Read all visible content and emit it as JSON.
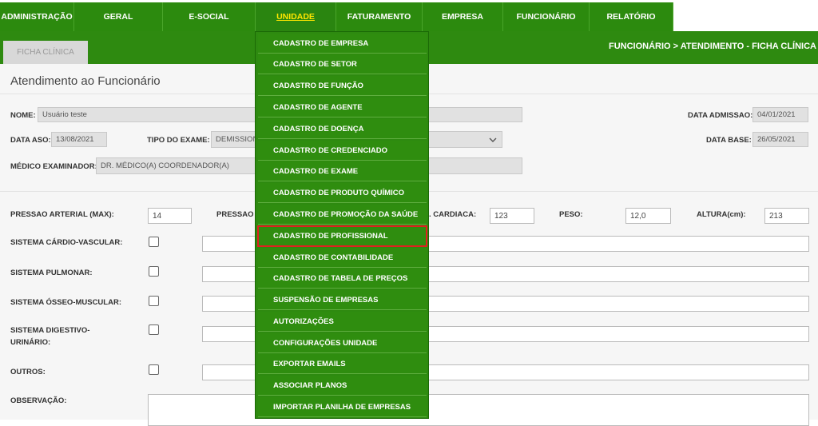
{
  "nav": {
    "items": [
      "ADMINISTRAÇÃO",
      "GERAL",
      "E-SOCIAL",
      "UNIDADE",
      "FATURAMENTO",
      "EMPRESA",
      "FUNCIONÁRIO",
      "RELATÓRIO"
    ],
    "active": "UNIDADE"
  },
  "tab": {
    "label": "FICHA CLÍNICA"
  },
  "breadcrumb": "FUNCIONÁRIO > ATENDIMENTO - FICHA CLÍNICA",
  "page_title": "Atendimento ao Funcionário",
  "form": {
    "nome_label": "NOME:",
    "nome_value": "Usuário teste",
    "data_admissao_label": "DATA ADMISSAO:",
    "data_admissao_value": "04/01/2021",
    "data_aso_label": "DATA ASO:",
    "data_aso_value": "13/08/2021",
    "tipo_exame_label": "TIPO DO EXAME:",
    "tipo_exame_value": "DEMISSIONAL",
    "data_base_label": "DATA BASE:",
    "data_base_value": "26/05/2021",
    "medico_label": "MÉDICO EXAMINADOR:",
    "medico_value": "DR. MÉDICO(A) COORDENADOR(A)",
    "pressao_max_label": "PRESSAO ARTERIAL (MAX):",
    "pressao_max_value": "14",
    "pressao_min_label": "PRESSAO A",
    "freq_label": ". CARDIACA:",
    "freq_value": "123",
    "peso_label": "PESO:",
    "peso_value": "12,0",
    "altura_label": "ALTURA(cm):",
    "altura_value": "213",
    "sis_cardio": "SISTEMA CÁRDIO-VASCULAR:",
    "sis_pulmonar": "SISTEMA PULMONAR:",
    "sis_osseo": "SISTEMA ÓSSEO-MUSCULAR:",
    "sis_digestivo_1": "SISTEMA DIGESTIVO-",
    "sis_digestivo_2": "URINÁRIO:",
    "outros": "OUTROS:",
    "observacao": "OBSERVAÇÃO:"
  },
  "dropdown": {
    "items": [
      "CADASTRO DE EMPRESA",
      "CADASTRO DE SETOR",
      "CADASTRO DE FUNÇÃO",
      "CADASTRO DE AGENTE",
      "CADASTRO DE DOENÇA",
      "CADASTRO DE CREDENCIADO",
      "CADASTRO DE EXAME",
      "CADASTRO DE PRODUTO QUÍMICO",
      "CADASTRO DE PROMOÇÃO DA SAÚDE",
      "CADASTRO DE PROFISSIONAL",
      "CADASTRO DE CONTABILIDADE",
      "CADASTRO DE TABELA DE PREÇOS",
      "SUSPENSÃO DE EMPRESAS",
      "AUTORIZAÇÕES",
      "CONFIGURAÇÕES UNIDADE",
      "EXPORTAR EMAILS",
      "ASSOCIAR PLANOS",
      "IMPORTAR PLANILHA DE EMPRESAS"
    ],
    "highlighted": "CADASTRO DE PROFISSIONAL"
  },
  "colors": {
    "nav_green": "#2c8a0e",
    "active_text": "#ffe600",
    "highlight": "#e02020"
  }
}
